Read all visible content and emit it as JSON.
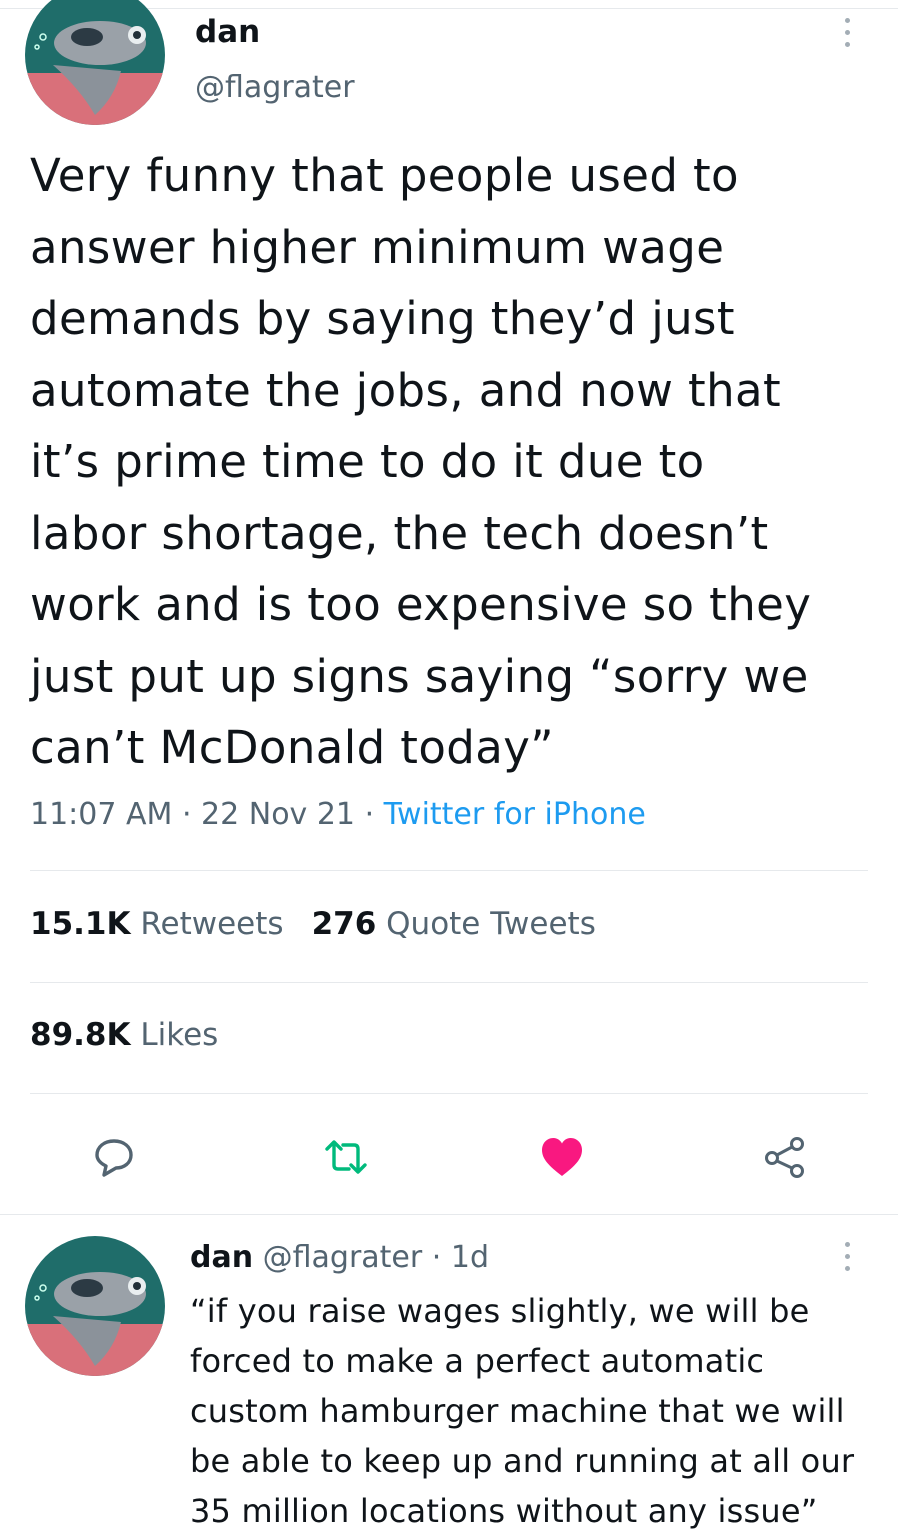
{
  "tweet": {
    "author_name": "dan",
    "author_handle": "@flagrater",
    "text": "Very funny that people used to\nanswer higher minimum wage\ndemands by saying they’d just\nautomate the jobs, and now that\nit’s prime time to do it due to\nlabor shortage, the tech doesn’t\nwork and is too expensive so they\njust put up signs saying “sorry we\ncan’t McDonald today”",
    "time": "11:07 AM",
    "date": "22 Nov 21",
    "separator": "·",
    "source": "Twitter for iPhone",
    "retweets_count": "15.1K",
    "retweets_label": "Retweets",
    "quotes_count": "276",
    "quotes_label": "Quote Tweets",
    "likes_count": "89.8K",
    "likes_label": "Likes",
    "liked": true,
    "actions": [
      {
        "name": "reply-icon"
      },
      {
        "name": "retweet-icon"
      },
      {
        "name": "like-icon"
      },
      {
        "name": "share-icon"
      }
    ]
  },
  "reply": {
    "author_name": "dan",
    "author_handle": "@flagrater",
    "separator": "·",
    "age": "1d",
    "text": "“if you raise wages slightly, we will be\nforced to make a perfect automatic\ncustom hamburger machine that we will\nbe able to keep up and running at all our\n35 million locations without any issue”"
  },
  "colors": {
    "text": "#0f1419",
    "secondary": "#536471",
    "link": "#1d9bf0",
    "retweet": "#00ba7c",
    "like": "#f91880",
    "divider": "#e6e9ec"
  }
}
